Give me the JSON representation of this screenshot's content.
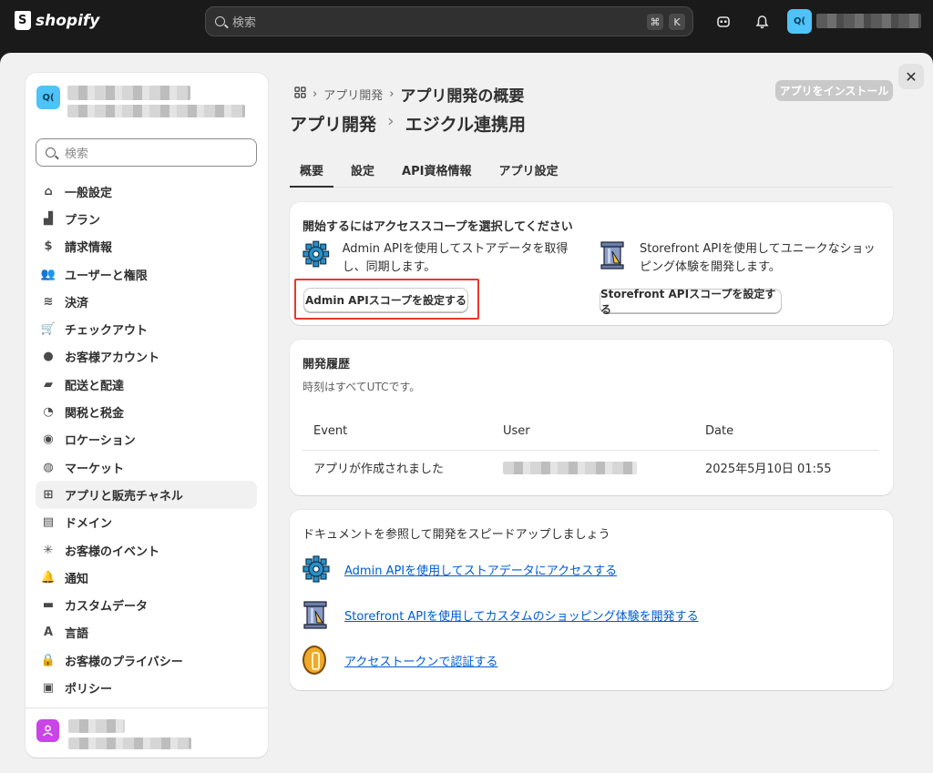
{
  "topbar": {
    "brand": "shopify",
    "search_placeholder": "検索",
    "shortcut_keys": [
      "⌘",
      "K"
    ]
  },
  "store": {
    "avatar_initials": "Q("
  },
  "sidebar": {
    "search_placeholder": "検索",
    "items": [
      {
        "label": "一般設定",
        "icon": "store-icon"
      },
      {
        "label": "プラン",
        "icon": "plan-chart-icon"
      },
      {
        "label": "請求情報",
        "icon": "billing-icon"
      },
      {
        "label": "ユーザーと権限",
        "icon": "users-icon"
      },
      {
        "label": "決済",
        "icon": "payments-icon"
      },
      {
        "label": "チェックアウト",
        "icon": "cart-icon"
      },
      {
        "label": "お客様アカウント",
        "icon": "person-icon"
      },
      {
        "label": "配送と配達",
        "icon": "truck-icon"
      },
      {
        "label": "関税と税金",
        "icon": "tax-icon"
      },
      {
        "label": "ロケーション",
        "icon": "location-icon"
      },
      {
        "label": "マーケット",
        "icon": "globe-icon"
      },
      {
        "label": "アプリと販売チャネル",
        "icon": "apps-icon",
        "active": true
      },
      {
        "label": "ドメイン",
        "icon": "domain-icon"
      },
      {
        "label": "お客様のイベント",
        "icon": "events-icon"
      },
      {
        "label": "通知",
        "icon": "bell-icon"
      },
      {
        "label": "カスタムデータ",
        "icon": "custom-data-icon"
      },
      {
        "label": "言語",
        "icon": "language-icon"
      },
      {
        "label": "お客様のプライバシー",
        "icon": "lock-icon"
      },
      {
        "label": "ポリシー",
        "icon": "policy-icon"
      }
    ]
  },
  "breadcrumb": {
    "parent": "アプリ開発",
    "current": "アプリ開発の概要"
  },
  "install_button": "アプリをインストール",
  "page_title": {
    "parent": "アプリ開発",
    "separator": "›",
    "app_name": "エジクル連携用"
  },
  "tabs": [
    "概要",
    "設定",
    "API資格情報",
    "アプリ設定"
  ],
  "scopes_card": {
    "title": "開始するにはアクセススコープを選択してください",
    "admin_text": "Admin APIを使用してストアデータを取得し、同期します。",
    "admin_button": "Admin APIスコープを設定する",
    "storefront_text": "Storefront APIを使用してユニークなショッピング体験を開発します。",
    "storefront_button": "Storefront APIスコープを設定する"
  },
  "history_card": {
    "title": "開発履歴",
    "subtitle": "時刻はすべてUTCです。",
    "columns": [
      "Event",
      "User",
      "Date"
    ],
    "rows": [
      {
        "event": "アプリが作成されました",
        "date": "2025年5月10日 01:55"
      }
    ]
  },
  "docs_card": {
    "title": "ドキュメントを参照して開発をスピードアップしましょう",
    "links": [
      "Admin APIを使用してストアデータにアクセスする",
      "Storefront APIを使用してカスタムのショッピング体験を開発する",
      "アクセストークンで認証する"
    ]
  },
  "colors": {
    "accent_link": "#005bd3",
    "highlight_box": "#e8392a",
    "store_avatar": "#4fc3f7",
    "user_avatar": "#c945e6"
  }
}
